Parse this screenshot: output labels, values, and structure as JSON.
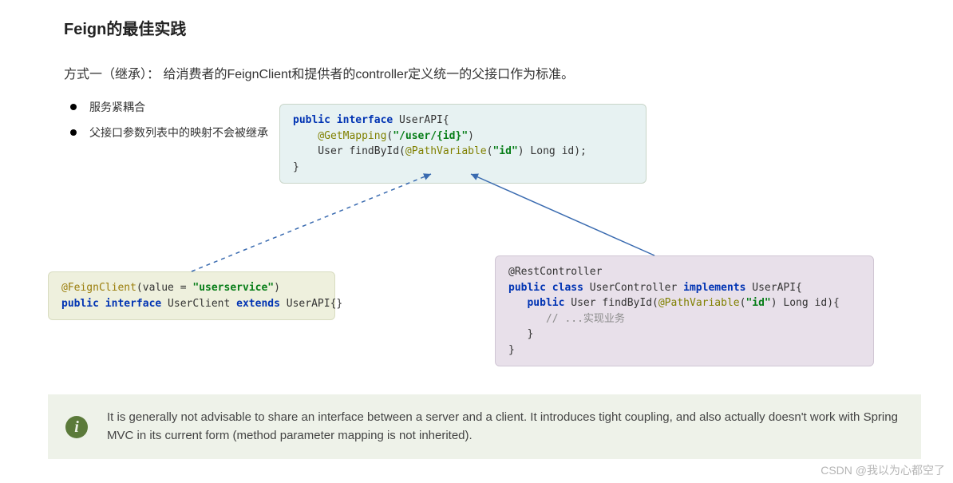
{
  "title": "Feign的最佳实践",
  "subtitle": "方式一（继承）： 给消费者的FeignClient和提供者的controller定义统一的父接口作为标准。",
  "bullets": [
    "服务紧耦合",
    "父接口参数列表中的映射不会被继承"
  ],
  "code_top": {
    "l1a": "public interface",
    "l1b": " UserAPI{",
    "l2a": "    @GetMapping",
    "l2b": "(",
    "l2c": "\"/user/{id}\"",
    "l2d": ")",
    "l3a": "    User findById(",
    "l3b": "@PathVariable",
    "l3c": "(",
    "l3d": "\"id\"",
    "l3e": ") Long id);",
    "l4": "}"
  },
  "code_left": {
    "l1a": "@FeignClient",
    "l1b": "(value = ",
    "l1c": "\"userservice\"",
    "l1d": ")",
    "l2a": "public interface",
    "l2b": " UserClient ",
    "l2c": "extends",
    "l2d": " UserAPI{}"
  },
  "code_right": {
    "l1": "@RestController",
    "l2a": "public class",
    "l2b": " UserController ",
    "l2c": "implements",
    "l2d": " UserAPI{",
    "l3a": "   public",
    "l3b": " User findById(",
    "l3c": "@PathVariable",
    "l3d": "(",
    "l3e": "\"id\"",
    "l3f": ") Long id){",
    "l4": "      // ...实现业务",
    "l5": "   }",
    "l6": "}"
  },
  "info_text": "It is generally not advisable to share an interface between a server and a client. It introduces tight coupling, and also actually doesn't work with Spring MVC in its current form (method parameter mapping is not inherited).",
  "info_icon_char": "i",
  "watermark": "CSDN @我以为心都空了"
}
